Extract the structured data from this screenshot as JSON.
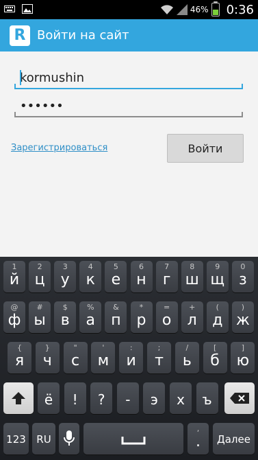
{
  "status": {
    "battery_percent": "46%",
    "time": "0:36"
  },
  "appbar": {
    "logo_letter": "R",
    "title": "Войти на сайт"
  },
  "login": {
    "username_value": "kormushin",
    "password_value": "••••••",
    "register_label": "Зарегистрироваться",
    "login_button": "Войти"
  },
  "keyboard": {
    "row1": [
      {
        "hint": "1",
        "char": "й"
      },
      {
        "hint": "2",
        "char": "ц"
      },
      {
        "hint": "3",
        "char": "у"
      },
      {
        "hint": "4",
        "char": "к"
      },
      {
        "hint": "5",
        "char": "е"
      },
      {
        "hint": "6",
        "char": "н"
      },
      {
        "hint": "7",
        "char": "г"
      },
      {
        "hint": "8",
        "char": "ш"
      },
      {
        "hint": "9",
        "char": "щ"
      },
      {
        "hint": "0",
        "char": "з"
      }
    ],
    "row2": [
      {
        "hint": "@",
        "char": "ф"
      },
      {
        "hint": "#",
        "char": "ы"
      },
      {
        "hint": "$",
        "char": "в"
      },
      {
        "hint": "%",
        "char": "а"
      },
      {
        "hint": "&",
        "char": "п"
      },
      {
        "hint": "*",
        "char": "р"
      },
      {
        "hint": "=",
        "char": "о"
      },
      {
        "hint": "+",
        "char": "л"
      },
      {
        "hint": "(",
        "char": "д"
      },
      {
        "hint": ")",
        "char": "ж"
      }
    ],
    "row3": [
      {
        "hint": "{",
        "char": "я"
      },
      {
        "hint": "}",
        "char": "ч"
      },
      {
        "hint": "\"",
        "char": "с"
      },
      {
        "hint": "'",
        "char": "м"
      },
      {
        "hint": ":",
        "char": "и"
      },
      {
        "hint": ";",
        "char": "т"
      },
      {
        "hint": "/",
        "char": "ь"
      },
      {
        "hint": "[",
        "char": "б"
      },
      {
        "hint": "]",
        "char": "ю"
      }
    ],
    "row4": [
      "ё",
      "!",
      "?",
      "-",
      "э",
      "х",
      "ъ"
    ],
    "mode_123": "123",
    "lang_key": "RU",
    "period_hint": ",",
    "period_char": ".",
    "done_label": "Далее"
  }
}
